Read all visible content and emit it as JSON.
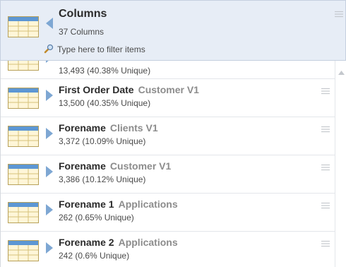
{
  "header": {
    "title": "Columns",
    "count": "37 Columns",
    "filter_placeholder": "Type here to filter items"
  },
  "icons": {
    "table": "table-icon",
    "collapse": "caret-left-icon",
    "expand": "caret-right-icon",
    "filter": "search-icon",
    "menu": "drag-handle-icon",
    "scroll_up": "scroll-up-arrow-icon"
  },
  "colors": {
    "header_bg": "#e7edf6",
    "arrow": "#7ea7d3",
    "table_name": "#8c8c8c"
  },
  "columns": [
    {
      "name": "",
      "table": "",
      "stats": "13,493 (40.38% Unique)"
    },
    {
      "name": "First Order Date",
      "table": "Customer V1",
      "stats": "13,500 (40.35% Unique)"
    },
    {
      "name": "Forename",
      "table": "Clients V1",
      "stats": "3,372 (10.09% Unique)"
    },
    {
      "name": "Forename",
      "table": "Customer V1",
      "stats": "3,386 (10.12% Unique)"
    },
    {
      "name": "Forename 1",
      "table": "Applications",
      "stats": "262 (0.65% Unique)"
    },
    {
      "name": "Forename 2",
      "table": "Applications",
      "stats": "242 (0.6% Unique)"
    }
  ]
}
